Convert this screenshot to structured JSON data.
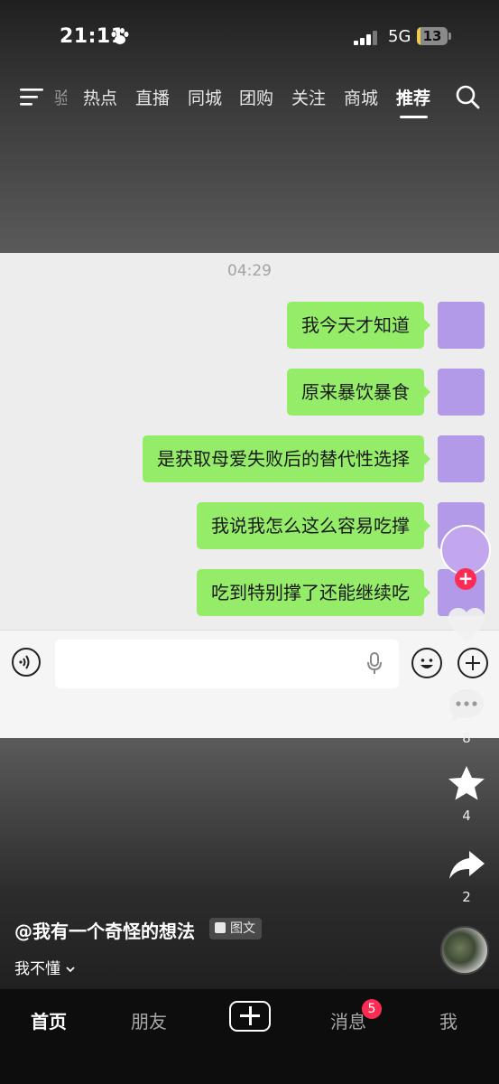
{
  "status_bar": {
    "time": "21:11",
    "network": "5G",
    "battery": "13",
    "battery_level": 0.13
  },
  "top_nav": {
    "tabs": [
      {
        "label": "验"
      },
      {
        "label": "热点"
      },
      {
        "label": "直播"
      },
      {
        "label": "同城"
      },
      {
        "label": "团购"
      },
      {
        "label": "关注"
      },
      {
        "label": "商城"
      },
      {
        "label": "推荐"
      }
    ],
    "active_tab": "推荐"
  },
  "chat": {
    "timestamp": "04:29",
    "messages": [
      {
        "text": "我今天才知道"
      },
      {
        "text": "原来暴饮暴食"
      },
      {
        "text": "是获取母爱失败后的替代性选择"
      },
      {
        "text": "我说我怎么这么容易吃撑"
      },
      {
        "text": "吃到特别撑了还能继续吃"
      }
    ]
  },
  "actions": {
    "likes": "",
    "comments": "8",
    "favorites": "4",
    "shares": "2"
  },
  "post": {
    "author": "@我有一个奇怪的想法",
    "tag": "图文",
    "description": "我不懂"
  },
  "bottom_tabs": {
    "home": "首页",
    "friends": "朋友",
    "messages": "消息",
    "messages_badge": "5",
    "me": "我"
  },
  "colors": {
    "chat_bubble": "#95ec69",
    "accent": "#fe2c55",
    "avatar": "#b39ae8"
  }
}
